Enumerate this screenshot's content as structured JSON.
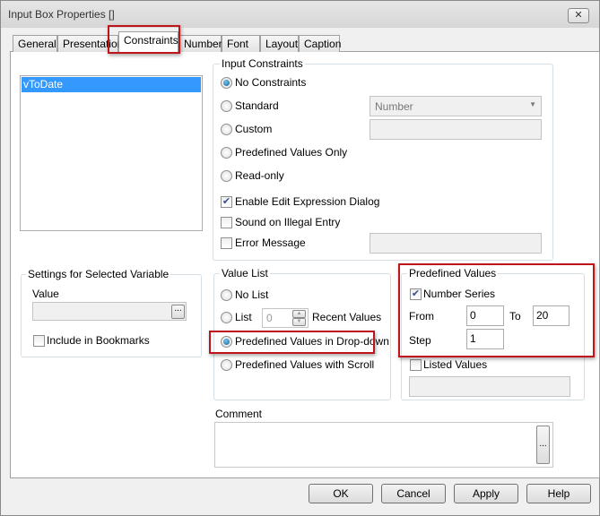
{
  "window": {
    "title": "Input Box Properties []",
    "close": "✕"
  },
  "tabs": [
    "General",
    "Presentation",
    "Constraints",
    "Number",
    "Font",
    "Layout",
    "Caption"
  ],
  "variables": [
    "vToDate"
  ],
  "input_constraints": {
    "title": "Input Constraints",
    "options": [
      "No Constraints",
      "Standard",
      "Custom",
      "Predefined Values Only",
      "Read-only"
    ],
    "selected": "No Constraints",
    "standard_dropdown": "Number",
    "checks": [
      {
        "label": "Enable Edit Expression Dialog",
        "checked": true
      },
      {
        "label": "Sound on Illegal Entry",
        "checked": false
      },
      {
        "label": "Error Message",
        "checked": false
      }
    ]
  },
  "settings": {
    "title": "Settings for Selected Variable",
    "value_label": "Value",
    "value": "",
    "browse": "...",
    "include_bookmarks": "Include in Bookmarks"
  },
  "value_list": {
    "title": "Value List",
    "options": [
      "No List",
      "List",
      "Predefined Values in Drop-down",
      "Predefined Values with Scroll"
    ],
    "selected": "Predefined Values in Drop-down",
    "list_count": "0",
    "recent_values": "Recent Values"
  },
  "predefined": {
    "title": "Predefined Values",
    "number_series": "Number Series",
    "number_series_checked": true,
    "from_label": "From",
    "from": "0",
    "to_label": "To",
    "to": "20",
    "step_label": "Step",
    "step": "1",
    "listed_values": "Listed Values"
  },
  "comment": {
    "label": "Comment",
    "value": "",
    "browse": "..."
  },
  "buttons": {
    "ok": "OK",
    "cancel": "Cancel",
    "apply": "Apply",
    "help": "Help"
  }
}
